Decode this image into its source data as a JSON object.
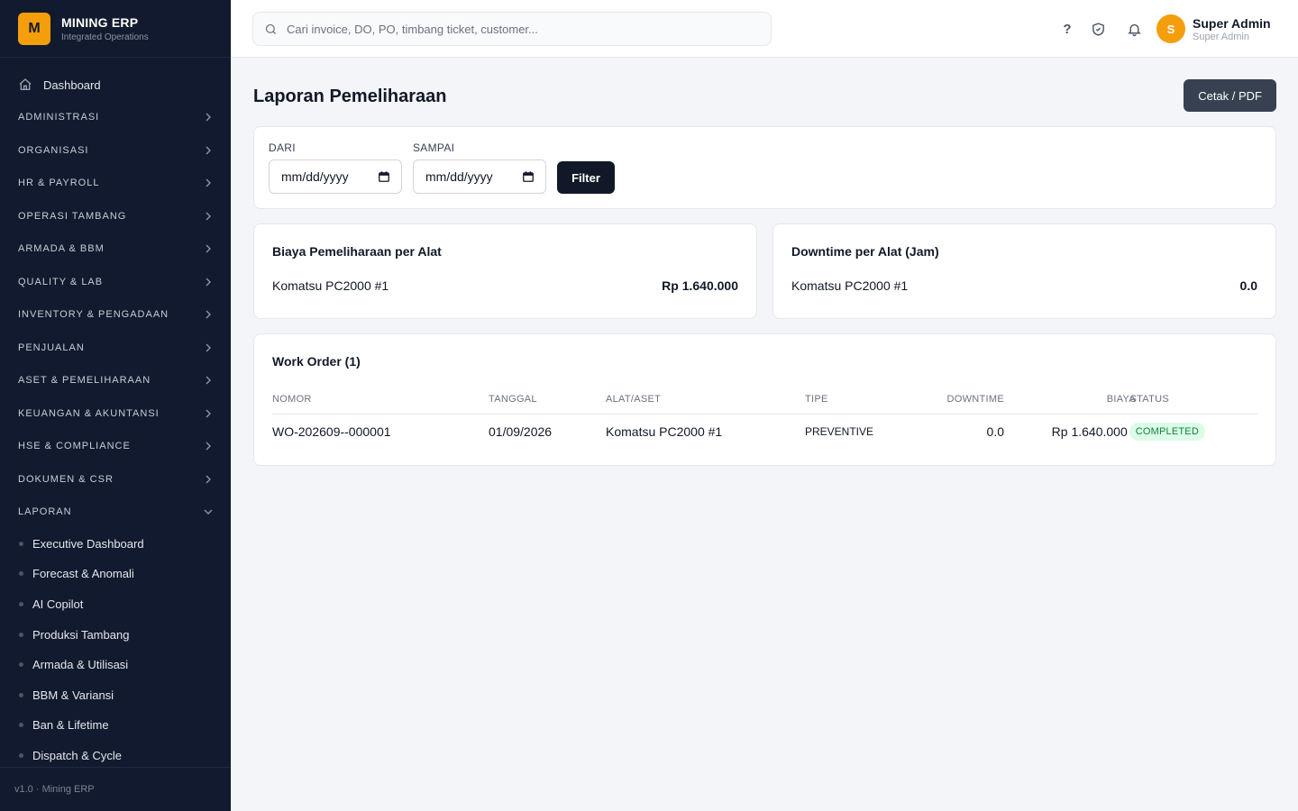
{
  "brand": {
    "title": "MINING ERP",
    "subtitle": "Integrated Operations",
    "logo_letter": "M"
  },
  "nav": {
    "dashboard": "Dashboard",
    "sections": [
      "ADMINISTRASI",
      "ORGANISASI",
      "HR & PAYROLL",
      "OPERASI TAMBANG",
      "ARMADA & BBM",
      "QUALITY & LAB",
      "INVENTORY & PENGADAAN",
      "PENJUALAN",
      "ASET & PEMELIHARAAN",
      "KEUANGAN & AKUNTANSI",
      "HSE & COMPLIANCE",
      "DOKUMEN & CSR"
    ],
    "open_section": "LAPORAN",
    "sub_items": [
      "Executive Dashboard",
      "Forecast & Anomali",
      "AI Copilot",
      "Produksi Tambang",
      "Armada & Utilisasi",
      "BBM & Variansi",
      "Ban & Lifetime",
      "Dispatch & Cycle"
    ]
  },
  "footer": "v1.0 · Mining ERP",
  "search": {
    "placeholder": "Cari invoice, DO, PO, timbang ticket, customer..."
  },
  "top_icons": {
    "help": "?"
  },
  "user": {
    "initial": "S",
    "name": "Super Admin",
    "role": "Super Admin"
  },
  "page": {
    "title": "Laporan Pemeliharaan",
    "print_label": "Cetak / PDF"
  },
  "filter": {
    "from_label": "DARI",
    "to_label": "SAMPAI",
    "from_value": "mm/dd/yyyy",
    "to_value": "mm/dd/yyyy",
    "button": "Filter"
  },
  "cost_card": {
    "title": "Biaya Pemeliharaan per Alat",
    "item": "Komatsu PC2000 #1",
    "value": "Rp 1.640.000"
  },
  "downtime_card": {
    "title": "Downtime per Alat (Jam)",
    "item": "Komatsu PC2000 #1",
    "value": "0.0"
  },
  "work_order": {
    "title": "Work Order (1)",
    "headers": {
      "nomor": "NOMOR",
      "tanggal": "TANGGAL",
      "alat": "ALAT/ASET",
      "tipe": "TIPE",
      "downtime": "DOWNTIME",
      "biaya": "BIAYA",
      "status": "STATUS"
    },
    "rows": [
      {
        "nomor": "WO-202609--000001",
        "tanggal": "01/09/2026",
        "alat": "Komatsu PC2000 #1",
        "tipe": "PREVENTIVE",
        "downtime": "0.0",
        "biaya": "Rp 1.640.000",
        "status": "COMPLETED"
      }
    ]
  },
  "colors": {
    "sidebar_bg": "#111a2e",
    "accent": "#f59e0b",
    "status_completed": "#15803d"
  }
}
